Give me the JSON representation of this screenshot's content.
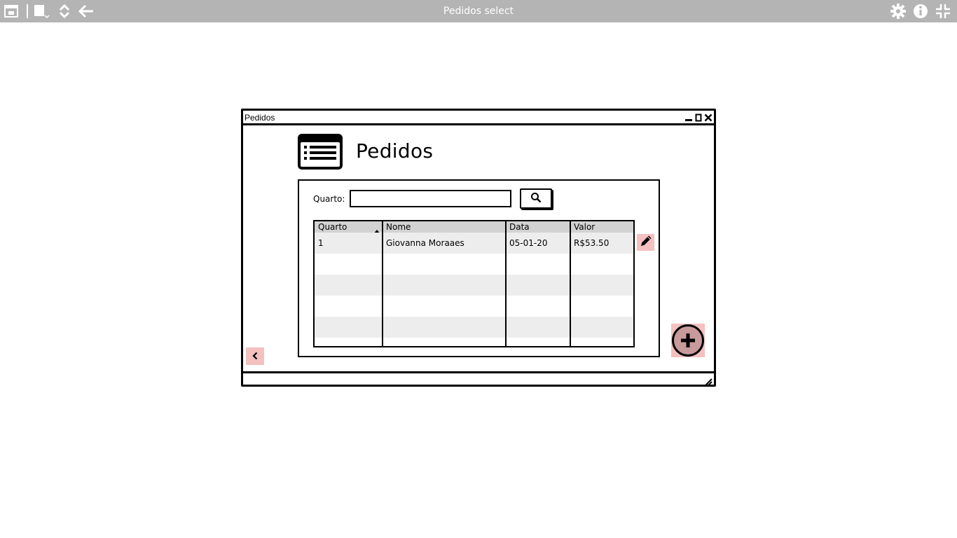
{
  "app": {
    "title": "Pedidos select"
  },
  "window": {
    "title": "Pedidos"
  },
  "header": {
    "title": "Pedidos",
    "icon": "list-icon"
  },
  "search": {
    "label": "Quarto:",
    "value": "",
    "placeholder": ""
  },
  "table": {
    "columns": [
      "Quarto",
      "Nome",
      "Data",
      "Valor"
    ],
    "sorted_column": "Quarto",
    "rows": [
      [
        "1",
        "Giovanna Moraaes",
        "05-01-20",
        "R$53.50"
      ]
    ],
    "empty_rows": 5
  },
  "colors": {
    "topbar": "#b4b4b4",
    "row_alt": "#ededed",
    "header": "#d2d2d2",
    "action_highlight": "#f4c0c0",
    "add_fill": "#c99a9c"
  },
  "icons": {
    "topbar_left": [
      "window-icon",
      "copy-icon",
      "sort-updown-icon",
      "back-arrow-icon"
    ],
    "topbar_right": [
      "gear-icon",
      "info-icon",
      "collapse-icon"
    ],
    "actions": [
      "pencil-icon",
      "plus-icon",
      "chevron-left-icon",
      "search-icon"
    ]
  }
}
